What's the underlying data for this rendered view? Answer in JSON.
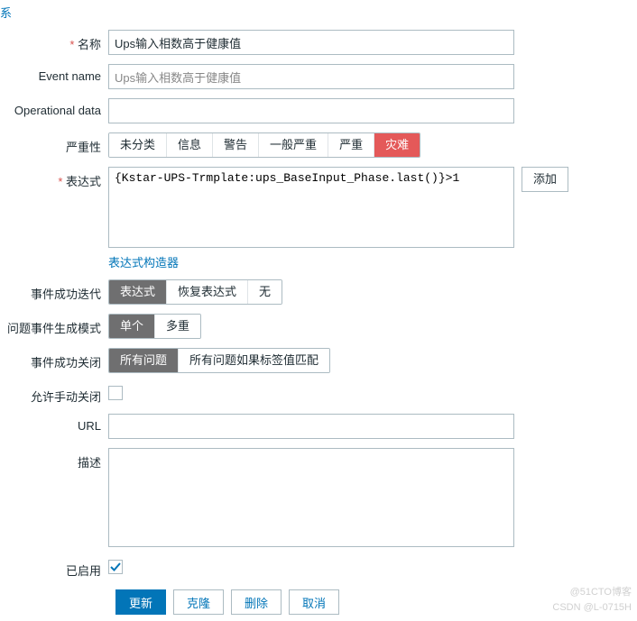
{
  "topLink": "系",
  "name": {
    "label": "名称",
    "value": "Ups输入相数高于健康值"
  },
  "eventName": {
    "label": "Event name",
    "value": "Ups输入相数高于健康值"
  },
  "operationalData": {
    "label": "Operational data",
    "value": ""
  },
  "severity": {
    "label": "严重性",
    "options": [
      "未分类",
      "信息",
      "警告",
      "一般严重",
      "严重",
      "灾难"
    ],
    "selectedIndex": 5
  },
  "expression": {
    "label": "表达式",
    "value": "{Kstar-UPS-Trmplate:ups_BaseInput_Phase.last()}>1",
    "addBtn": "添加",
    "builderLink": "表达式构造器"
  },
  "eventOkIter": {
    "label": "事件成功迭代",
    "options": [
      "表达式",
      "恢复表达式",
      "无"
    ],
    "selectedIndex": 0
  },
  "problemGen": {
    "label": "问题事件生成模式",
    "options": [
      "单个",
      "多重"
    ],
    "selectedIndex": 0
  },
  "eventOkClose": {
    "label": "事件成功关闭",
    "options": [
      "所有问题",
      "所有问题如果标签值匹配"
    ],
    "selectedIndex": 0
  },
  "manualClose": {
    "label": "允许手动关闭",
    "checked": false
  },
  "url": {
    "label": "URL",
    "value": ""
  },
  "description": {
    "label": "描述",
    "value": ""
  },
  "enabled": {
    "label": "已启用",
    "checked": true
  },
  "buttons": {
    "update": "更新",
    "clone": "克隆",
    "delete": "删除",
    "cancel": "取消"
  },
  "watermark1": "@51CTO博客",
  "watermark2": "CSDN @L-0715H"
}
